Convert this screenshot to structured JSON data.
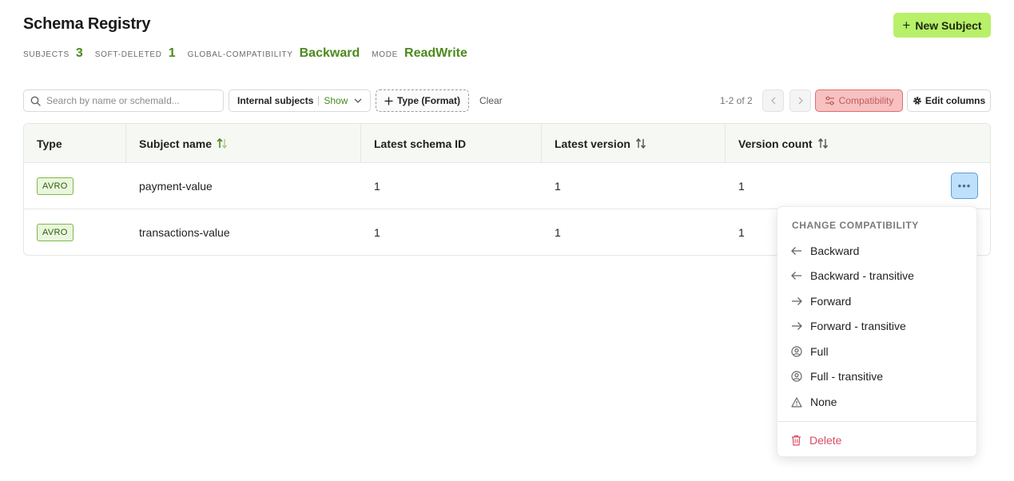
{
  "header": {
    "title": "Schema Registry",
    "new_subject_label": "New Subject"
  },
  "stats": [
    {
      "label": "SUBJECTS",
      "value": "3"
    },
    {
      "label": "SOFT-DELETED",
      "value": "1"
    },
    {
      "label": "GLOBAL-COMPATIBILITY",
      "value": "Backward"
    },
    {
      "label": "MODE",
      "value": "ReadWrite"
    }
  ],
  "toolbar": {
    "search_placeholder": "Search by name or schemaId...",
    "internal_label": "Internal subjects",
    "internal_value": "Show",
    "type_filter_label": "Type (Format)",
    "clear_label": "Clear",
    "pagination_text": "1-2 of 2",
    "compatibility_label": "Compatibility",
    "edit_columns_label": "Edit columns"
  },
  "table": {
    "columns": [
      "Type",
      "Subject name",
      "Latest schema ID",
      "Latest version",
      "Version count"
    ],
    "rows": [
      {
        "type": "AVRO",
        "subject": "payment-value",
        "schema_id": "1",
        "latest_version": "1",
        "version_count": "1"
      },
      {
        "type": "AVRO",
        "subject": "transactions-value",
        "schema_id": "1",
        "latest_version": "1",
        "version_count": "1"
      }
    ]
  },
  "dropdown": {
    "heading": "CHANGE COMPATIBILITY",
    "items": [
      {
        "label": "Backward",
        "icon": "arrow-left-icon"
      },
      {
        "label": "Backward - transitive",
        "icon": "arrow-left-icon"
      },
      {
        "label": "Forward",
        "icon": "arrow-right-icon"
      },
      {
        "label": "Forward - transitive",
        "icon": "arrow-right-icon"
      },
      {
        "label": "Full",
        "icon": "user-circle-icon"
      },
      {
        "label": "Full - transitive",
        "icon": "user-circle-icon"
      },
      {
        "label": "None",
        "icon": "warning-icon"
      }
    ],
    "delete_label": "Delete"
  },
  "colors": {
    "accent_green": "#4c8a1c",
    "primary_button": "#b8f06a",
    "danger": "#d84e64"
  }
}
